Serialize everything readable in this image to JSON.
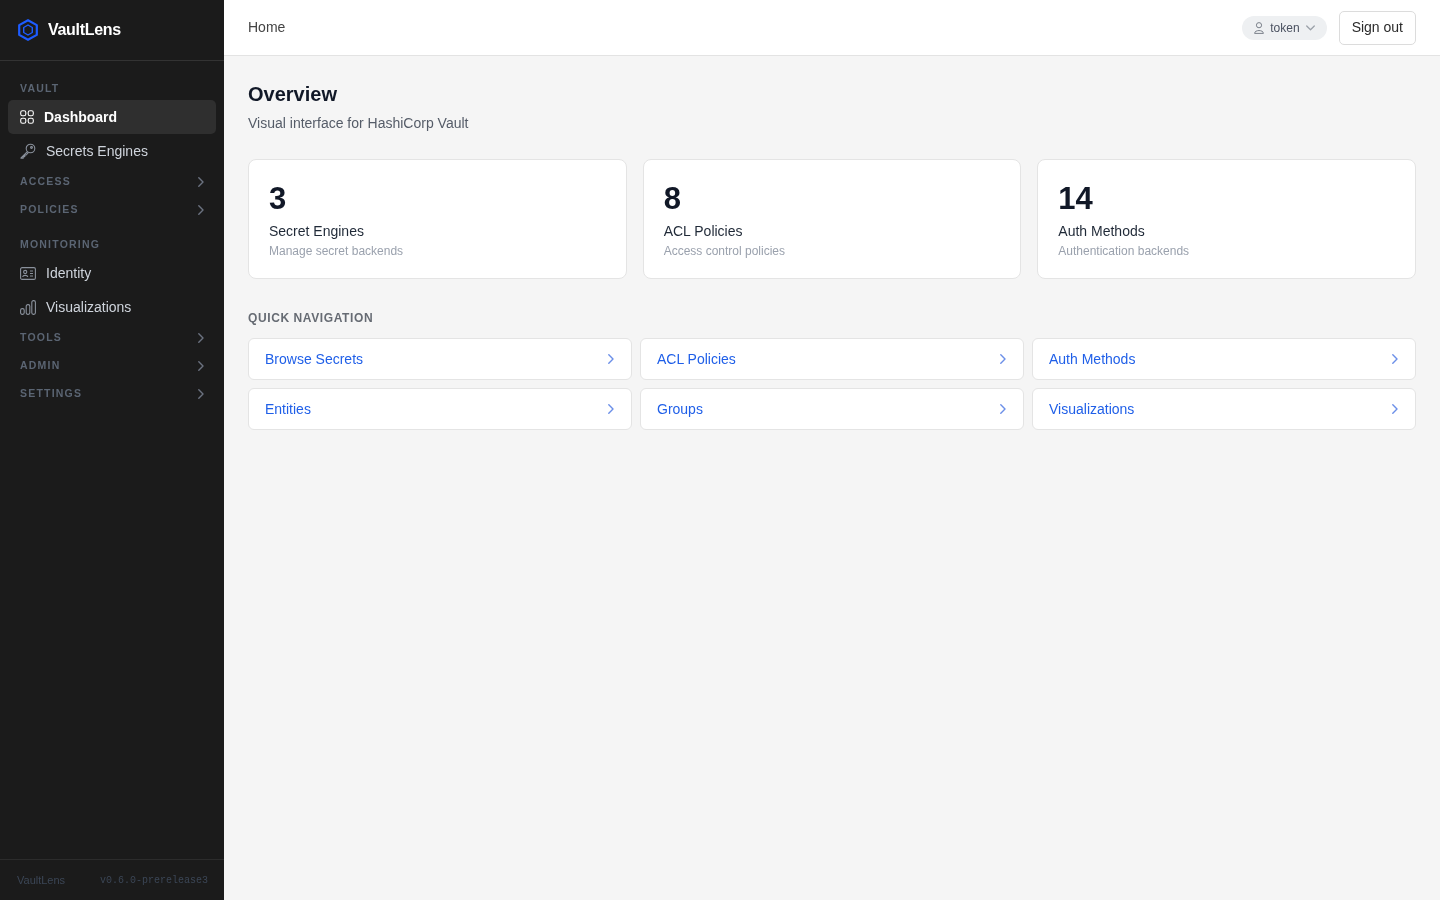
{
  "sidebar": {
    "brand": "VaultLens",
    "groups": [
      {
        "kind": "section",
        "label": "VAULT",
        "items": [
          {
            "label": "Dashboard",
            "selected": true
          },
          {
            "label": "Secrets Engines",
            "selected": false
          }
        ]
      },
      {
        "kind": "collapsible",
        "label": "ACCESS",
        "expanded": false
      },
      {
        "kind": "collapsible",
        "label": "POLICIES",
        "expanded": false
      },
      {
        "kind": "section",
        "label": "MONITORING",
        "items": [
          {
            "label": "Identity",
            "selected": false
          },
          {
            "label": "Visualizations",
            "selected": false
          }
        ]
      },
      {
        "kind": "collapsible",
        "label": "TOOLS",
        "expanded": false
      },
      {
        "kind": "collapsible",
        "label": "ADMIN",
        "expanded": false
      },
      {
        "kind": "collapsible",
        "label": "SETTINGS",
        "expanded": false
      }
    ],
    "footer": {
      "name": "VaultLens",
      "version": "v0.6.0-prerelease3"
    }
  },
  "topbar": {
    "breadcrumb": "Home",
    "user": "token",
    "sign_out": "Sign out"
  },
  "page": {
    "title": "Overview",
    "subtitle": "Visual interface for HashiCorp Vault",
    "stats": [
      {
        "value": "3",
        "label": "Secret Engines",
        "description": "Manage secret backends"
      },
      {
        "value": "8",
        "label": "ACL Policies",
        "description": "Access control policies"
      },
      {
        "value": "14",
        "label": "Auth Methods",
        "description": "Authentication backends"
      }
    ],
    "quick_nav": {
      "heading": "QUICK NAVIGATION",
      "links": [
        "Browse Secrets",
        "ACL Policies",
        "Auth Methods",
        "Entities",
        "Groups",
        "Visualizations"
      ]
    }
  }
}
